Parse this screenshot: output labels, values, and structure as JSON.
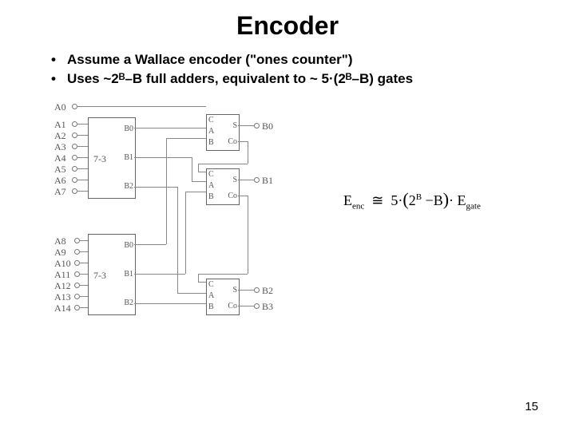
{
  "title": "Encoder",
  "bullets": [
    "Assume a Wallace encoder (\"ones counter\")",
    "Uses ~2ᴮ–B full adders, equivalent to ~ 5·(2ᴮ–B) gates"
  ],
  "equation": {
    "lhs_base": "E",
    "lhs_sub": "enc",
    "approx": "≅",
    "factor": "5",
    "dot": "·",
    "paren_base": "2",
    "paren_sup": "B",
    "minus": "−",
    "paren_term2": "B",
    "rhs_base": "E",
    "rhs_sub": "gate"
  },
  "diagram": {
    "inputs_top": [
      "A0",
      "A1",
      "A2",
      "A3",
      "A4",
      "A5",
      "A6",
      "A7"
    ],
    "inputs_bot": [
      "A8",
      "A9",
      "A10",
      "A11",
      "A12",
      "A13",
      "A14"
    ],
    "enc_box_label": "7-3",
    "enc_out_labels": [
      "B0",
      "B1",
      "B2"
    ],
    "fa_pins": {
      "c": "C",
      "s": "S",
      "a": "A",
      "b": "B",
      "co": "Co"
    },
    "outputs": [
      "B0",
      "B1",
      "B2",
      "B3"
    ]
  },
  "page_number": "15"
}
